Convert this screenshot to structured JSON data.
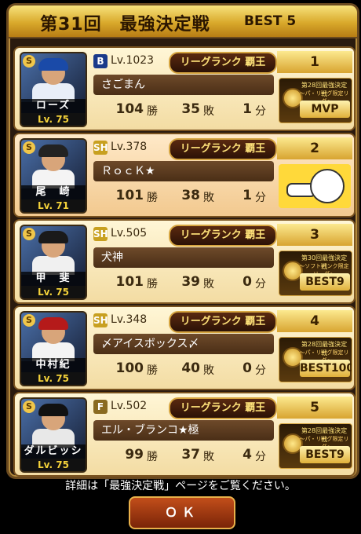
{
  "header": {
    "title": "第31回　最強決定戦",
    "best_label": "BEST 5"
  },
  "rank_badge_label": "リーグランク 覇王",
  "stat_units": {
    "win": "勝",
    "loss": "敗",
    "draw": "分"
  },
  "rows": [
    {
      "rank": "1",
      "user_level": "Lv.1023",
      "team_mark": "B",
      "team_color": "#1a3a8a",
      "user_name": "さごまん",
      "wins": "104",
      "losses": "35",
      "draws": "1",
      "player_name": "ローズ",
      "player_level": "Lv. 75",
      "award": {
        "line1": "第28回最強決定戦",
        "line2": "～パ・リーグ限定リーグ～",
        "big": "MVP"
      }
    },
    {
      "rank": "2",
      "user_level": "Lv.378",
      "team_mark": "SH",
      "team_color": "#c8a020",
      "user_name": "ＲｏｃＫ★",
      "wins": "101",
      "losses": "38",
      "draws": "1",
      "player_name": "尾　崎",
      "player_level": "Lv. 71",
      "award": null
    },
    {
      "rank": "3",
      "user_level": "Lv.505",
      "team_mark": "SH",
      "team_color": "#c8a020",
      "user_name": "犬神",
      "wins": "101",
      "losses": "39",
      "draws": "0",
      "player_name": "甲　斐",
      "player_level": "Lv. 75",
      "award": {
        "line1": "第30回最強決定戦",
        "line2": "～ソフトバンク限定リーグ～",
        "big": "BEST9"
      }
    },
    {
      "rank": "4",
      "user_level": "Lv.348",
      "team_mark": "SH",
      "team_color": "#c8a020",
      "user_name": "〆アイスボックス〆",
      "wins": "100",
      "losses": "40",
      "draws": "0",
      "player_name": "中村紀",
      "player_level": "Lv. 75",
      "award": {
        "line1": "第28回最強決定戦",
        "line2": "～パ・リーグ限定リーグ～",
        "big": "BEST100"
      }
    },
    {
      "rank": "5",
      "user_level": "Lv.502",
      "team_mark": "F",
      "team_color": "#8a6a20",
      "user_name": "エル・ブランコ★極",
      "wins": "99",
      "losses": "37",
      "draws": "4",
      "player_name": "ダルビッシュ",
      "player_level": "Lv. 75",
      "award": {
        "line1": "第28回最強決定戦",
        "line2": "～パ・リーグ限定リーグ～",
        "big": "BEST9"
      }
    }
  ],
  "footer": {
    "note": "詳細は「最強決定戦」ページをご覧ください。",
    "ok_label": "ＯＫ"
  }
}
